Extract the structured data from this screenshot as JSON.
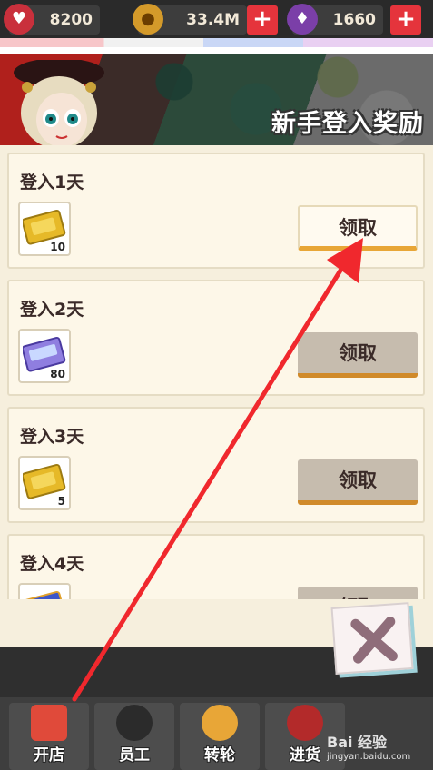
{
  "resources": {
    "hearts": "8200",
    "coins": "33.4M",
    "potions": "1660"
  },
  "banner": {
    "title": "新手登入奖励"
  },
  "rewards": [
    {
      "day_label": "登入1天",
      "item_count": "10",
      "item_type": "gold-ticket",
      "button_label": "领取",
      "state": "active"
    },
    {
      "day_label": "登入2天",
      "item_count": "80",
      "item_type": "purple-card",
      "button_label": "领取",
      "state": "inactive"
    },
    {
      "day_label": "登入3天",
      "item_count": "5",
      "item_type": "gold-ticket",
      "button_label": "领取",
      "state": "inactive"
    },
    {
      "day_label": "登入4天",
      "item_count": "",
      "item_type": "blue-ticket",
      "button_label": "领取",
      "state": "inactive"
    }
  ],
  "nav": [
    {
      "label": "开店",
      "icon": "shop-icon"
    },
    {
      "label": "员工",
      "icon": "staff-icon"
    },
    {
      "label": "转轮",
      "icon": "wheel-icon"
    },
    {
      "label": "进货",
      "icon": "delivery-icon"
    }
  ],
  "watermark": {
    "brand": "Bai 经验",
    "url": "jingyan.baidu.com"
  },
  "colors": {
    "accent": "#e5343c",
    "claim_underline": "#e8a637",
    "arrow": "#f0282d"
  }
}
